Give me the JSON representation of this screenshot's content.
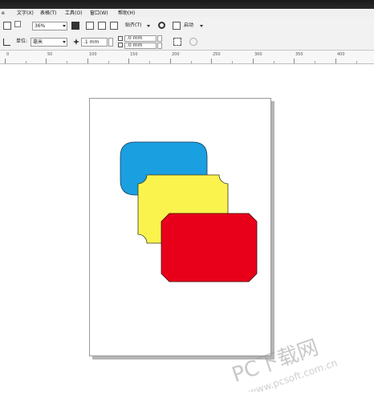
{
  "menubar": {
    "items": [
      {
        "label": "文字(X)"
      },
      {
        "label": "表格(T)"
      },
      {
        "label": "工具(O)"
      },
      {
        "label": "窗口(W)"
      },
      {
        "label": "帮助(H)"
      }
    ]
  },
  "toolbar": {
    "zoom_value": "36%",
    "snap_label": "贴齐(T)",
    "launch_label": "启动"
  },
  "property_bar": {
    "unit_label": "单位:",
    "unit_value": "毫米",
    "nudge_value": ".1 mm",
    "dup_x_value": ".0 mm",
    "dup_y_value": ".0 mm"
  },
  "ruler": {
    "ticks": [
      "0",
      "50",
      "100",
      "150",
      "200",
      "250",
      "300",
      "350",
      "400"
    ]
  },
  "shapes": [
    {
      "name": "blue-rounded-rect",
      "color": "#1a9fe0"
    },
    {
      "name": "yellow-notched-rect",
      "color": "#fbf34d"
    },
    {
      "name": "red-chamfered-rect",
      "color": "#e8001b"
    }
  ],
  "watermark": {
    "line1": "PC下载网",
    "line2": "www.pcsoft.com.cn"
  }
}
